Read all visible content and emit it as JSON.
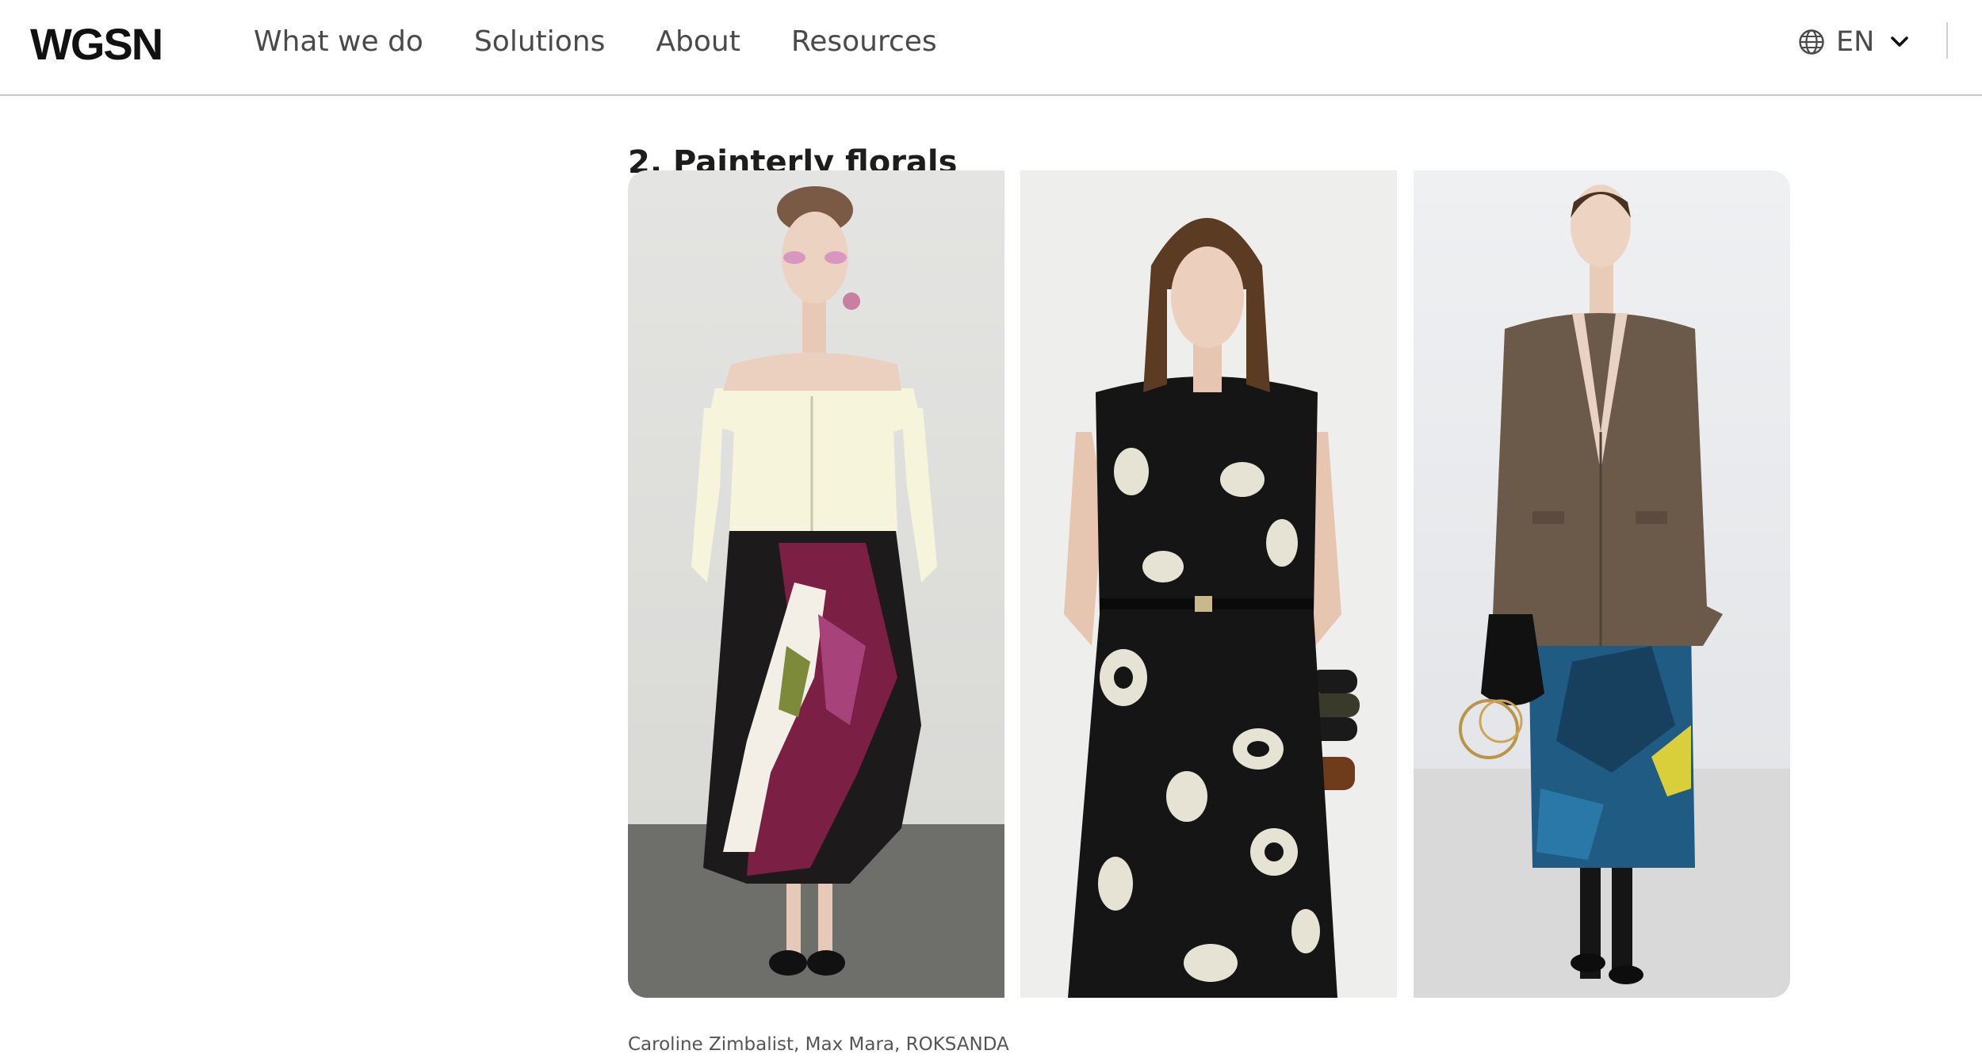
{
  "brand": {
    "logo_text": "WGSN"
  },
  "nav": {
    "items": [
      "What we do",
      "Solutions",
      "About",
      "Resources"
    ]
  },
  "language": {
    "label": "EN"
  },
  "icons": {
    "language": "globe-icon",
    "dropdown": "chevron-down-icon"
  },
  "article": {
    "section_title": "2. Painterly florals",
    "caption": "Caroline Zimbalist, Max Mara, ROKSANDA"
  }
}
